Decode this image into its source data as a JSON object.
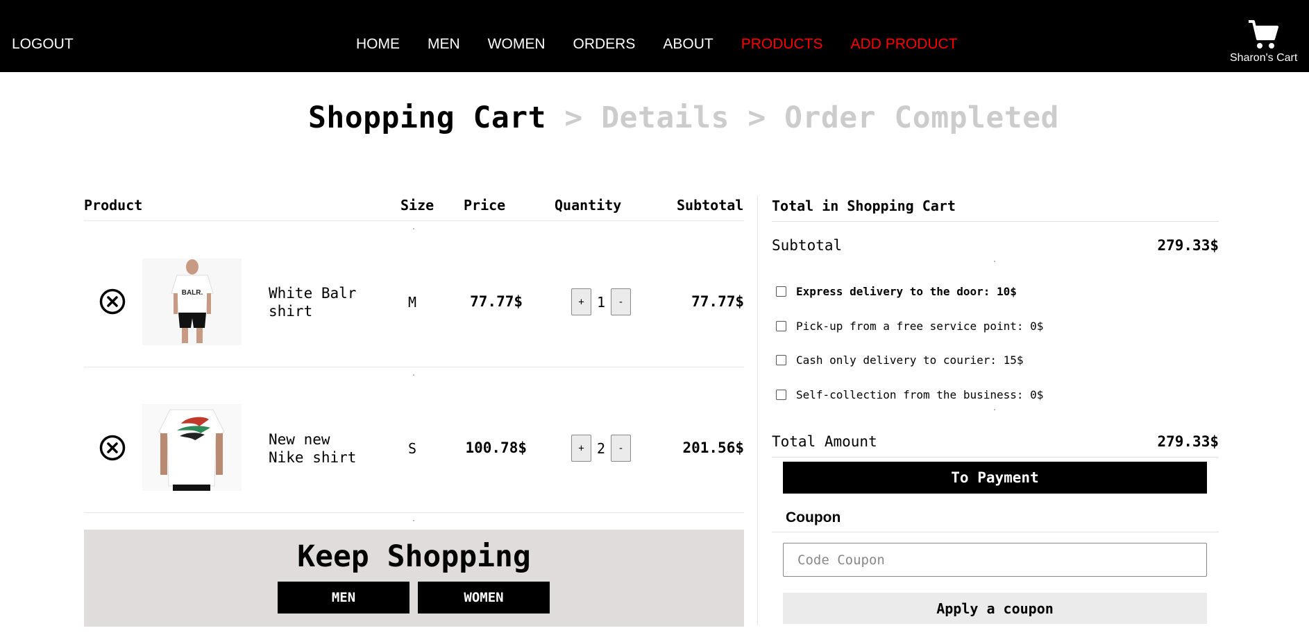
{
  "nav": {
    "logout": "LOGOUT",
    "links": [
      "HOME",
      "MEN",
      "WOMEN",
      "ORDERS",
      "ABOUT",
      "PRODUCTS",
      "ADD PRODUCT"
    ],
    "cart_label": "Sharon's Cart",
    "cart_icon": "shopping-cart-icon",
    "highlight_color": "#ff0000"
  },
  "steps": {
    "current": "Shopping Cart",
    "rest": " > Details > Order Completed"
  },
  "table": {
    "headers": {
      "product": "Product",
      "size": "Size",
      "price": "Price",
      "quantity": "Quantity",
      "subtotal": "Subtotal"
    },
    "rows": [
      {
        "name": "White Balr shirt",
        "size": "M",
        "price": "77.77$",
        "quantity": "1",
        "subtotal": "77.77$",
        "plus": "+",
        "minus": "-",
        "remove_icon": "remove-circle-x-icon"
      },
      {
        "name": "New new Nike shirt",
        "size": "S",
        "price": "100.78$",
        "quantity": "2",
        "subtotal": "201.56$",
        "plus": "+",
        "minus": "-",
        "remove_icon": "remove-circle-x-icon"
      }
    ]
  },
  "keep_shopping": {
    "title": "Keep Shopping",
    "men": "MEN",
    "women": "WOMEN"
  },
  "summary": {
    "title": "Total in Shopping Cart",
    "subtotal_label": "Subtotal",
    "subtotal_value": "279.33$",
    "options": [
      "Express delivery to the door: 10$",
      "Pick-up from a free service point: 0$",
      "Cash only delivery to courier: 15$",
      "Self-collection from the business: 0$"
    ],
    "total_label": "Total Amount",
    "total_value": "279.33$",
    "pay_button": "To Payment",
    "coupon_title": "Coupon",
    "coupon_placeholder": "Code Coupon",
    "apply_button": "Apply a coupon"
  }
}
